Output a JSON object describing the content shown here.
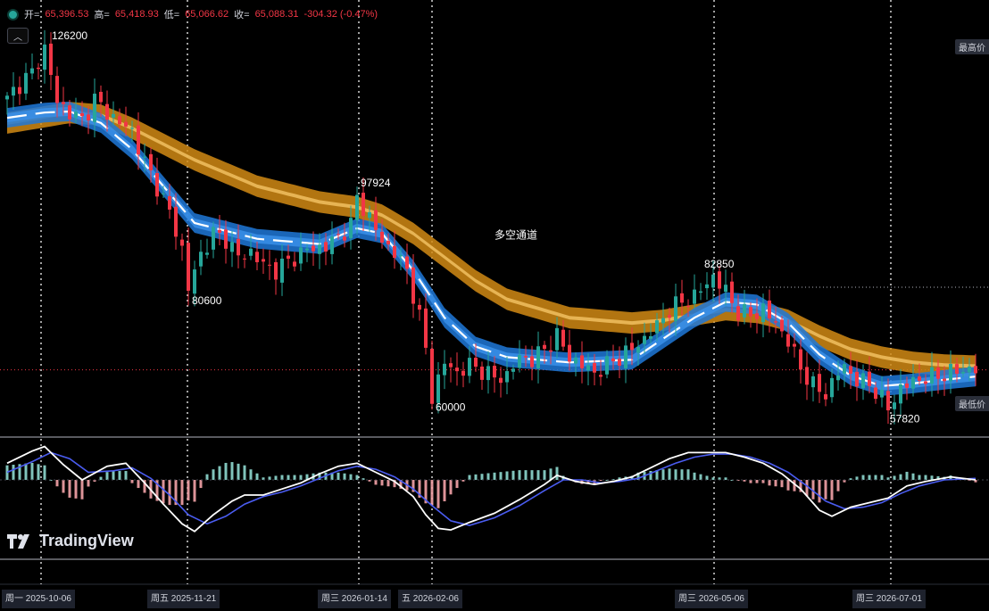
{
  "ohlc": {
    "open_label": "开=",
    "open": "65,396.53",
    "high_label": "高=",
    "high": "65,418.93",
    "low_label": "低=",
    "low": "65,066.62",
    "close_label": "收=",
    "close": "65,088.31",
    "change": "-304.32 (-0.47%)"
  },
  "collapse_icon": "chevron-down-icon",
  "tags": {
    "highest": "最高价",
    "lowest": "最低价"
  },
  "watermark": "TradingView",
  "date_labels": [
    "周一 2025-10-06",
    "周五 2025-11-21",
    "周三 2026-01-14",
    "五 2026-02-06",
    "周三 2026-05-06",
    "周三 2026-07-01"
  ],
  "colors": {
    "up": "#26a69a",
    "down": "#f23645",
    "blue_band": "#1e78d8",
    "orange_band": "#d18a14",
    "macd_line": "#ffffff",
    "signal_line": "#4a5cf0"
  },
  "chart_data": {
    "type": "candlestick",
    "title": "",
    "ylim": [
      54000,
      132000
    ],
    "annotations": [
      {
        "text": "126200",
        "x": 6,
        "y": 126200
      },
      {
        "text": "80600",
        "x": 29,
        "y": 80600
      },
      {
        "text": "97924",
        "x": 56,
        "y": 97924
      },
      {
        "text": "60000",
        "x": 68,
        "y": 60000
      },
      {
        "text": "多空通道",
        "x": 78,
        "y": 90000
      },
      {
        "text": "82850",
        "x": 113,
        "y": 82850
      },
      {
        "text": "57820",
        "x": 141,
        "y": 57820
      }
    ],
    "keypoints": [
      [
        0,
        116500
      ],
      [
        2,
        119500
      ],
      [
        4,
        121500
      ],
      [
        6,
        126200
      ],
      [
        8,
        116000
      ],
      [
        10,
        114000
      ],
      [
        12,
        112500
      ],
      [
        14,
        116500
      ],
      [
        16,
        114000
      ],
      [
        18,
        112000
      ],
      [
        20,
        110500
      ],
      [
        22,
        104500
      ],
      [
        24,
        100000
      ],
      [
        26,
        95000
      ],
      [
        28,
        88000
      ],
      [
        29,
        80600
      ],
      [
        31,
        87000
      ],
      [
        33,
        91000
      ],
      [
        35,
        90000
      ],
      [
        37,
        86500
      ],
      [
        39,
        87500
      ],
      [
        41,
        85000
      ],
      [
        43,
        84000
      ],
      [
        46,
        86500
      ],
      [
        48,
        88000
      ],
      [
        51,
        88500
      ],
      [
        53,
        90500
      ],
      [
        55,
        92500
      ],
      [
        56,
        97924
      ],
      [
        58,
        94000
      ],
      [
        60,
        89500
      ],
      [
        62,
        87500
      ],
      [
        64,
        84000
      ],
      [
        66,
        75000
      ],
      [
        67,
        69000
      ],
      [
        68,
        60000
      ],
      [
        70,
        66500
      ],
      [
        72,
        64500
      ],
      [
        74,
        66000
      ],
      [
        76,
        65000
      ],
      [
        78,
        63500
      ],
      [
        80,
        64000
      ],
      [
        82,
        67500
      ],
      [
        84,
        67000
      ],
      [
        86,
        69000
      ],
      [
        88,
        71500
      ],
      [
        90,
        67500
      ],
      [
        92,
        66000
      ],
      [
        94,
        64500
      ],
      [
        96,
        66000
      ],
      [
        98,
        67500
      ],
      [
        100,
        69000
      ],
      [
        102,
        71000
      ],
      [
        104,
        73500
      ],
      [
        106,
        76500
      ],
      [
        108,
        78000
      ],
      [
        110,
        79000
      ],
      [
        113,
        82850
      ],
      [
        115,
        80000
      ],
      [
        117,
        76000
      ],
      [
        119,
        75500
      ],
      [
        121,
        76500
      ],
      [
        123,
        74000
      ],
      [
        125,
        70500
      ],
      [
        127,
        65500
      ],
      [
        129,
        62000
      ],
      [
        131,
        60500
      ],
      [
        133,
        64500
      ],
      [
        134,
        65800
      ],
      [
        136,
        63000
      ],
      [
        138,
        62500
      ],
      [
        140,
        59500
      ],
      [
        141,
        57820
      ],
      [
        143,
        61500
      ],
      [
        145,
        63000
      ],
      [
        147,
        63500
      ],
      [
        149,
        64000
      ],
      [
        151,
        64500
      ],
      [
        153,
        65200
      ],
      [
        155,
        65088
      ]
    ],
    "channel": {
      "blue_mid": [
        [
          0,
          113000
        ],
        [
          6,
          114000
        ],
        [
          10,
          114200
        ],
        [
          15,
          112000
        ],
        [
          20,
          107000
        ],
        [
          25,
          100000
        ],
        [
          30,
          93000
        ],
        [
          40,
          90000
        ],
        [
          50,
          89000
        ],
        [
          56,
          92000
        ],
        [
          60,
          91000
        ],
        [
          65,
          84000
        ],
        [
          70,
          75000
        ],
        [
          75,
          69500
        ],
        [
          80,
          67500
        ],
        [
          90,
          66500
        ],
        [
          100,
          67000
        ],
        [
          105,
          71000
        ],
        [
          110,
          75000
        ],
        [
          115,
          78000
        ],
        [
          120,
          77500
        ],
        [
          125,
          74000
        ],
        [
          130,
          68000
        ],
        [
          135,
          64000
        ],
        [
          140,
          62000
        ],
        [
          145,
          62500
        ],
        [
          150,
          63200
        ],
        [
          155,
          63800
        ]
      ],
      "orange_mid": [
        [
          0,
          112000
        ],
        [
          10,
          114000
        ],
        [
          15,
          113500
        ],
        [
          20,
          111000
        ],
        [
          30,
          105000
        ],
        [
          40,
          100000
        ],
        [
          50,
          97000
        ],
        [
          56,
          96000
        ],
        [
          60,
          94500
        ],
        [
          65,
          91000
        ],
        [
          70,
          86500
        ],
        [
          75,
          82000
        ],
        [
          80,
          78500
        ],
        [
          90,
          75000
        ],
        [
          100,
          74000
        ],
        [
          105,
          74500
        ],
        [
          110,
          75500
        ],
        [
          115,
          76500
        ],
        [
          120,
          76000
        ],
        [
          125,
          74500
        ],
        [
          130,
          71500
        ],
        [
          135,
          69000
        ],
        [
          140,
          67500
        ],
        [
          145,
          66500
        ],
        [
          150,
          66000
        ],
        [
          155,
          65800
        ]
      ]
    },
    "macd": {
      "macd_line": [
        [
          0,
          0.55
        ],
        [
          4,
          0.95
        ],
        [
          6,
          1.1
        ],
        [
          9,
          0.5
        ],
        [
          12,
          0.0
        ],
        [
          16,
          0.45
        ],
        [
          19,
          0.55
        ],
        [
          22,
          -0.1
        ],
        [
          25,
          -0.8
        ],
        [
          28,
          -1.45
        ],
        [
          30,
          -1.7
        ],
        [
          33,
          -1.15
        ],
        [
          36,
          -0.7
        ],
        [
          38,
          -0.5
        ],
        [
          41,
          -0.5
        ],
        [
          44,
          -0.3
        ],
        [
          47,
          -0.1
        ],
        [
          50,
          0.2
        ],
        [
          53,
          0.45
        ],
        [
          56,
          0.55
        ],
        [
          59,
          0.25
        ],
        [
          62,
          -0.05
        ],
        [
          65,
          -0.55
        ],
        [
          67,
          -1.15
        ],
        [
          69,
          -1.6
        ],
        [
          71,
          -1.65
        ],
        [
          74,
          -1.4
        ],
        [
          78,
          -1.1
        ],
        [
          82,
          -0.65
        ],
        [
          86,
          -0.15
        ],
        [
          88,
          0.15
        ],
        [
          91,
          -0.05
        ],
        [
          94,
          -0.15
        ],
        [
          97,
          -0.05
        ],
        [
          100,
          0.1
        ],
        [
          103,
          0.4
        ],
        [
          106,
          0.7
        ],
        [
          109,
          0.9
        ],
        [
          112,
          0.9
        ],
        [
          115,
          0.9
        ],
        [
          118,
          0.75
        ],
        [
          121,
          0.55
        ],
        [
          124,
          0.2
        ],
        [
          127,
          -0.3
        ],
        [
          130,
          -1.0
        ],
        [
          132,
          -1.2
        ],
        [
          135,
          -0.9
        ],
        [
          138,
          -0.75
        ],
        [
          141,
          -0.6
        ],
        [
          144,
          -0.2
        ],
        [
          147,
          -0.05
        ],
        [
          151,
          0.1
        ],
        [
          155,
          0.0
        ]
      ],
      "signal_line": [
        [
          0,
          0.25
        ],
        [
          4,
          0.6
        ],
        [
          7,
          0.9
        ],
        [
          10,
          0.7
        ],
        [
          13,
          0.25
        ],
        [
          17,
          0.3
        ],
        [
          20,
          0.4
        ],
        [
          23,
          0.05
        ],
        [
          26,
          -0.5
        ],
        [
          29,
          -1.15
        ],
        [
          32,
          -1.45
        ],
        [
          35,
          -1.2
        ],
        [
          38,
          -0.8
        ],
        [
          41,
          -0.55
        ],
        [
          44,
          -0.4
        ],
        [
          47,
          -0.2
        ],
        [
          50,
          0.05
        ],
        [
          53,
          0.3
        ],
        [
          56,
          0.45
        ],
        [
          59,
          0.35
        ],
        [
          62,
          0.1
        ],
        [
          65,
          -0.3
        ],
        [
          68,
          -0.85
        ],
        [
          71,
          -1.35
        ],
        [
          74,
          -1.5
        ],
        [
          78,
          -1.25
        ],
        [
          82,
          -0.85
        ],
        [
          86,
          -0.35
        ],
        [
          89,
          0.0
        ],
        [
          92,
          0.0
        ],
        [
          95,
          -0.1
        ],
        [
          98,
          -0.05
        ],
        [
          101,
          0.05
        ],
        [
          104,
          0.3
        ],
        [
          107,
          0.55
        ],
        [
          110,
          0.75
        ],
        [
          113,
          0.85
        ],
        [
          116,
          0.85
        ],
        [
          119,
          0.75
        ],
        [
          122,
          0.55
        ],
        [
          125,
          0.25
        ],
        [
          128,
          -0.2
        ],
        [
          131,
          -0.7
        ],
        [
          134,
          -0.95
        ],
        [
          137,
          -0.9
        ],
        [
          140,
          -0.75
        ],
        [
          143,
          -0.45
        ],
        [
          146,
          -0.2
        ],
        [
          150,
          0.0
        ],
        [
          155,
          0.05
        ]
      ]
    }
  }
}
